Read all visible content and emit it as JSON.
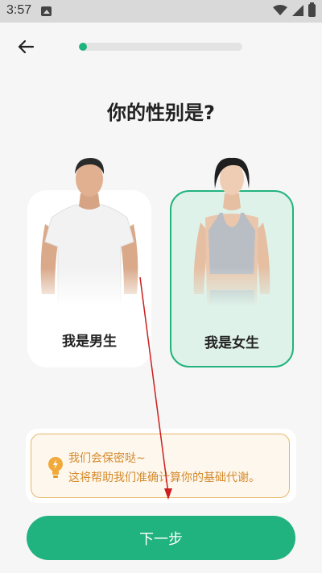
{
  "status_bar": {
    "time": "3:57"
  },
  "nav": {
    "back_icon": "arrow-left-icon",
    "progress": 0.05
  },
  "question": "你的性别是?",
  "options": [
    {
      "label": "我是男生",
      "selected": false
    },
    {
      "label": "我是女生",
      "selected": true
    }
  ],
  "tip": {
    "icon": "lightbulb-icon",
    "line1": "我们会保密哒~",
    "line2": "这将帮助我们准确计算你的基础代谢。"
  },
  "next_button": "下一步",
  "colors": {
    "accent": "#20b27f",
    "tip_text": "#d58a2a",
    "annotation_arrow": "#cc1f1f"
  }
}
